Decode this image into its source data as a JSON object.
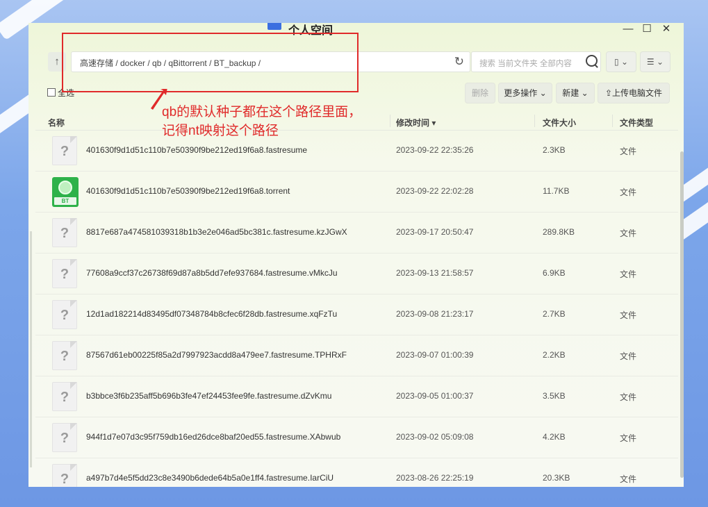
{
  "window": {
    "title": "个人空间"
  },
  "toolbar": {
    "up_label": "↑",
    "path": "高速存储 / docker / qb / qBittorrent / BT_backup /",
    "search_placeholder": "搜索 当前文件夹 全部内容",
    "select_all_label": "全选",
    "delete_label": "删除",
    "more_label": "更多操作 ⌄",
    "new_label": "新建 ⌄",
    "upload_label": "上传电脑文件"
  },
  "columns": {
    "name": "名称",
    "modified": "修改时间 ▾",
    "size": "文件大小",
    "type": "文件类型"
  },
  "files": [
    {
      "icon": "unknown-file-icon",
      "name": "401630f9d1d51c110b7e50390f9be212ed19f6a8.fastresume",
      "modified": "2023-09-22 22:35:26",
      "size": "2.3KB",
      "type": "文件"
    },
    {
      "icon": "bt-torrent-icon",
      "name": "401630f9d1d51c110b7e50390f9be212ed19f6a8.torrent",
      "modified": "2023-09-22 22:02:28",
      "size": "11.7KB",
      "type": "文件"
    },
    {
      "icon": "unknown-file-icon",
      "name": "8817e687a474581039318b1b3e2e046ad5bc381c.fastresume.kzJGwX",
      "modified": "2023-09-17 20:50:47",
      "size": "289.8KB",
      "type": "文件"
    },
    {
      "icon": "unknown-file-icon",
      "name": "77608a9ccf37c26738f69d87a8b5dd7efe937684.fastresume.vMkcJu",
      "modified": "2023-09-13 21:58:57",
      "size": "6.9KB",
      "type": "文件"
    },
    {
      "icon": "unknown-file-icon",
      "name": "12d1ad182214d83495df07348784b8cfec6f28db.fastresume.xqFzTu",
      "modified": "2023-09-08 21:23:17",
      "size": "2.7KB",
      "type": "文件"
    },
    {
      "icon": "unknown-file-icon",
      "name": "87567d61eb00225f85a2d7997923acdd8a479ee7.fastresume.TPHRxF",
      "modified": "2023-09-07 01:00:39",
      "size": "2.2KB",
      "type": "文件"
    },
    {
      "icon": "unknown-file-icon",
      "name": "b3bbce3f6b235aff5b696b3fe47ef24453fee9fe.fastresume.dZvKmu",
      "modified": "2023-09-05 01:00:37",
      "size": "3.5KB",
      "type": "文件"
    },
    {
      "icon": "unknown-file-icon",
      "name": "944f1d7e07d3c95f759db16ed26dce8baf20ed55.fastresume.XAbwub",
      "modified": "2023-09-02 05:09:08",
      "size": "4.2KB",
      "type": "文件"
    },
    {
      "icon": "unknown-file-icon",
      "name": "a497b7d4e5f5dd23c8e3490b6dede64b5a0e1ff4.fastresume.IarCiU",
      "modified": "2023-08-26 22:25:19",
      "size": "20.3KB",
      "type": "文件"
    }
  ],
  "annotation": {
    "line1": "qb的默认种子都在这个路径里面，",
    "line2": "记得nt映射这个路径",
    "color": "#e02a2a"
  },
  "colors": {
    "accent": "#3b6fe0",
    "bt_green": "#2eb24a"
  }
}
